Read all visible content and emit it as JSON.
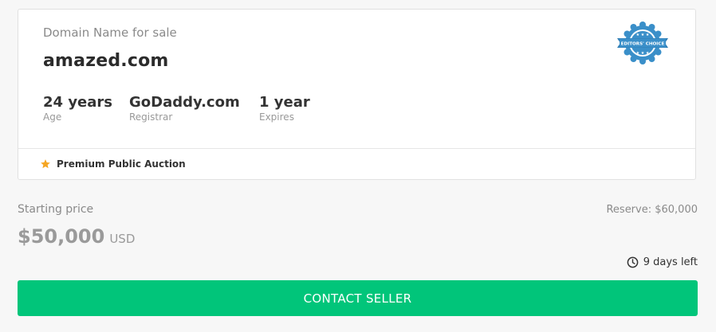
{
  "listing": {
    "label": "Domain Name for sale",
    "domain": "amazed.com",
    "stats": [
      {
        "value": "24 years",
        "label": "Age"
      },
      {
        "value": "GoDaddy.com",
        "label": "Registrar"
      },
      {
        "value": "1 year",
        "label": "Expires"
      }
    ],
    "badge": {
      "icon": "editors-choice-badge",
      "text": "EDITORS' CHOICE",
      "color": "#3a8fc9"
    },
    "auction_type": "Premium Public Auction",
    "star_color": "#f5a623"
  },
  "pricing": {
    "starting_label": "Starting price",
    "price": "$50,000",
    "currency": "USD",
    "reserve": "Reserve: $60,000",
    "time_left": "9 days left"
  },
  "actions": {
    "contact_label": "CONTACT SELLER",
    "contact_color": "#01c57a"
  }
}
